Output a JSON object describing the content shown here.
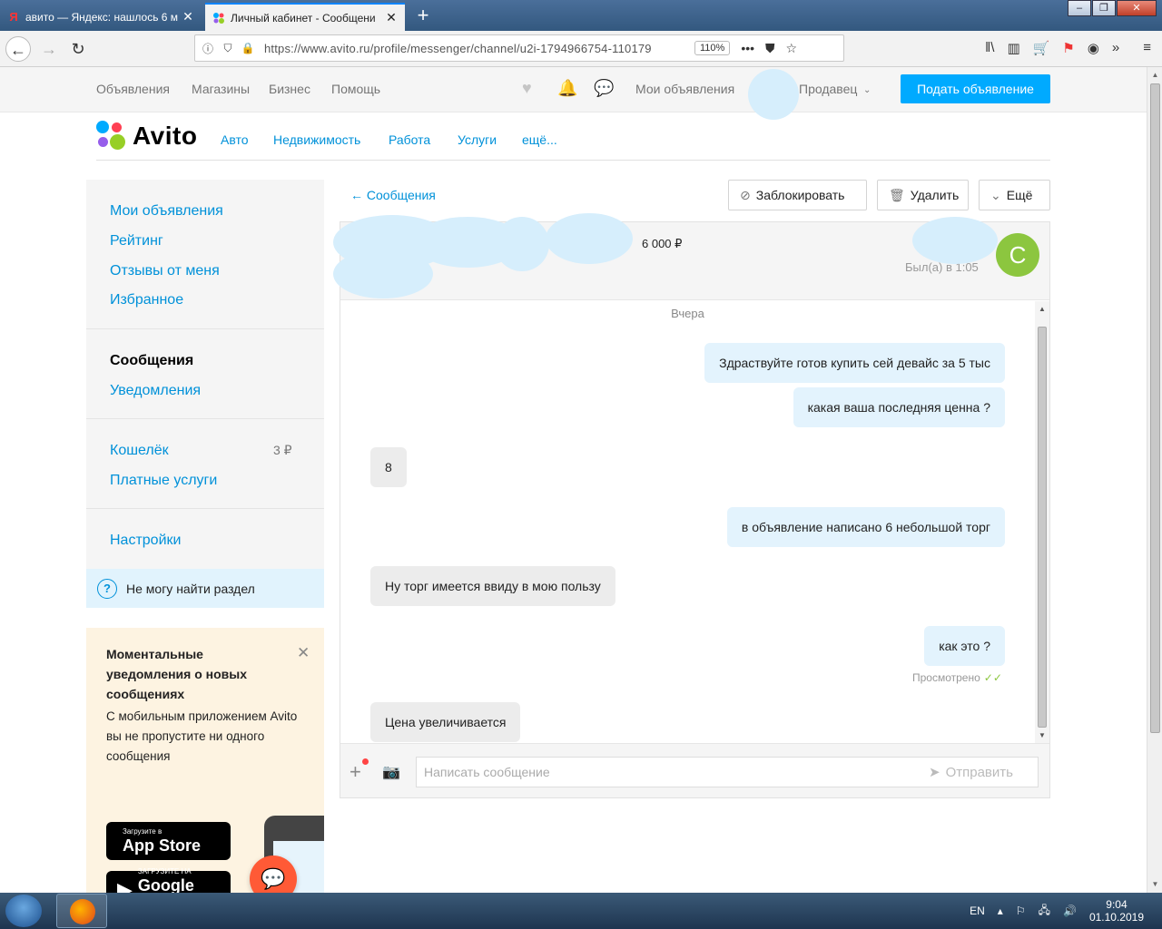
{
  "browser": {
    "tabs": [
      {
        "title": "авито — Яндекс: нашлось 6 м",
        "icon": "yandex-icon",
        "active": false
      },
      {
        "title": "Личный кабинет - Сообщени",
        "icon": "avito-icon",
        "active": true
      }
    ],
    "url": "https://www.avito.ru/profile/messenger/channel/u2i-1794966754-110179",
    "zoom": "110%"
  },
  "topbar": {
    "links": [
      "Объявления",
      "Магазины",
      "Бизнес",
      "Помощь"
    ],
    "my_ads": "Мои объявления",
    "user": "Продавец",
    "post_button": "Подать объявление"
  },
  "logo_text": "Avito",
  "categories": [
    "Авто",
    "Недвижимость",
    "Работа",
    "Услуги",
    "ещё..."
  ],
  "sidebar": {
    "group1": [
      "Мои объявления",
      "Рейтинг",
      "Отзывы от меня",
      "Избранное"
    ],
    "messages": "Сообщения",
    "notifications": "Уведомления",
    "wallet": "Кошелёк",
    "wallet_count": "3 ₽",
    "paid": "Платные услуги",
    "settings": "Настройки",
    "help": "Не могу найти раздел"
  },
  "promo": {
    "title": "Моментальные уведомления о новых сообщениях",
    "text": "С мобильным приложением Avito вы не пропустите ни одного сообщения",
    "appstore_small": "Загрузите в",
    "appstore_big": "App Store",
    "googleplay_small": "ЗАГРУЗИТЕ НА",
    "googleplay_big": "Google Play"
  },
  "chat": {
    "back": "← Сообщения",
    "block": "Заблокировать",
    "delete": "Удалить",
    "more": "Ещё",
    "price": "6 000 ₽",
    "seen": "Был(а) в 1:05",
    "avatar_letter": "С",
    "day": "Вчера",
    "messages": [
      {
        "text": "Здраствуйте готов купить сей девайс за 5 тыс",
        "dir": "out"
      },
      {
        "text": "какая ваша последняя ценна ?",
        "dir": "out"
      },
      {
        "text": "8",
        "dir": "in"
      },
      {
        "text": "в объявление написано 6 небольшой торг",
        "dir": "out"
      },
      {
        "text": "Ну торг имеется ввиду в мою пользу",
        "dir": "in"
      },
      {
        "text": "как это ?",
        "dir": "out"
      },
      {
        "text": "Цена увеличивается",
        "dir": "in"
      }
    ],
    "read_label": "Просмотрено",
    "input_placeholder": "Написать сообщение",
    "send": "Отправить"
  },
  "taskbar": {
    "lang": "EN",
    "time": "9:04",
    "date": "01.10.2019"
  }
}
